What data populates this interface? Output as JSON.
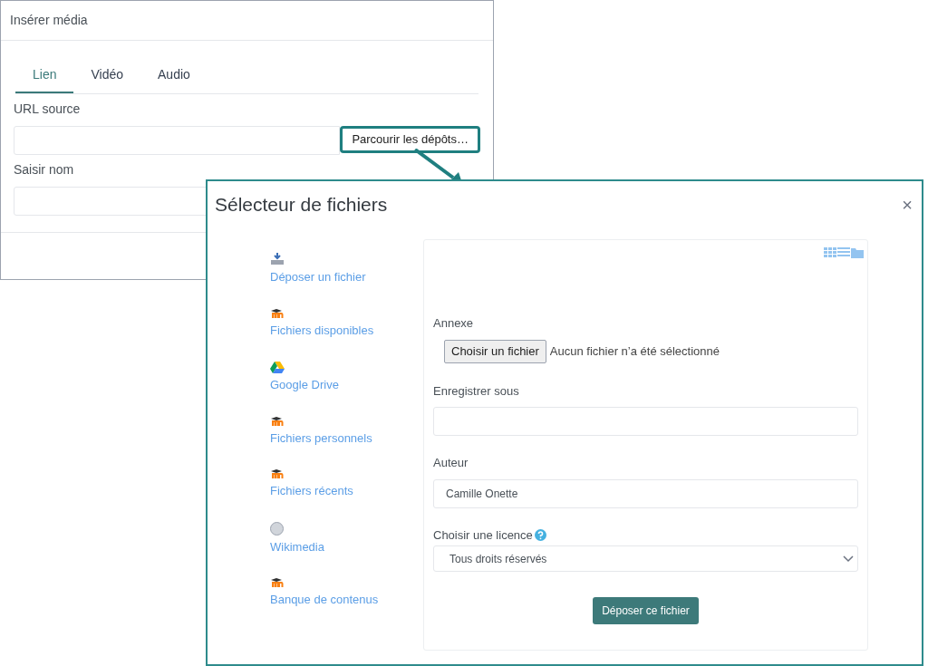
{
  "media_dialog": {
    "title": "Insérer média",
    "tabs": [
      {
        "label": "Lien",
        "selected": true
      },
      {
        "label": "Vidéo",
        "selected": false
      },
      {
        "label": "Audio",
        "selected": false
      }
    ],
    "url_label": "URL source",
    "browse_button": "Parcourir les dépôts…",
    "name_label": "Saisir nom"
  },
  "file_picker": {
    "title": "Sélecteur de fichiers",
    "close": "×",
    "repositories": [
      {
        "label": "Déposer un fichier",
        "kind": "upload"
      },
      {
        "label": "Fichiers disponibles",
        "kind": "moodle"
      },
      {
        "label": "Google Drive",
        "kind": "drive"
      },
      {
        "label": "Fichiers personnels",
        "kind": "moodle"
      },
      {
        "label": "Fichiers récents",
        "kind": "moodle"
      },
      {
        "label": "Wikimedia",
        "kind": "wiki"
      },
      {
        "label": "Banque de contenus",
        "kind": "moodle"
      }
    ],
    "attachment_label": "Annexe",
    "choose_button": "Choisir un fichier",
    "no_file_text": "Aucun fichier n’a été sélectionné",
    "save_as_label": "Enregistrer sous",
    "author_label": "Auteur",
    "author_value": "Camille Onette",
    "license_label": "Choisir une licence",
    "license_value": "Tous droits réservés",
    "upload_button": "Déposer ce fichier"
  }
}
